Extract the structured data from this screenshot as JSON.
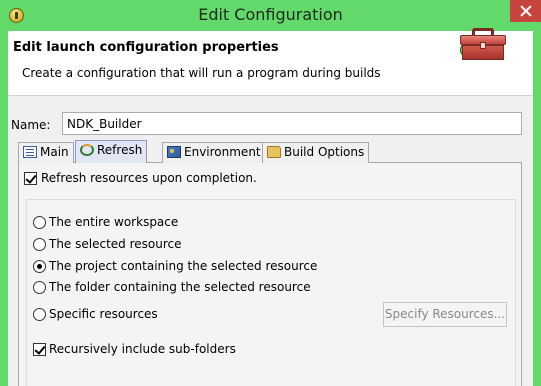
{
  "window": {
    "title": "Edit Configuration"
  },
  "header": {
    "heading": "Edit launch configuration properties",
    "description": "Create a configuration that will run a program during builds"
  },
  "name": {
    "label": "Name:",
    "value": "NDK_Builder"
  },
  "tabs": [
    {
      "label": "Main",
      "icon": "main-tab-icon",
      "active": false
    },
    {
      "label": "Refresh",
      "icon": "refresh-icon",
      "active": true
    },
    {
      "label": "Environment",
      "icon": "environment-icon",
      "active": false
    },
    {
      "label": "Build Options",
      "icon": "build-options-icon",
      "active": false
    }
  ],
  "refresh": {
    "refresh_on_completion": {
      "label": "Refresh resources upon completion.",
      "checked": true
    },
    "scope_options": [
      {
        "label": "The entire workspace",
        "selected": false
      },
      {
        "label": "The selected resource",
        "selected": false
      },
      {
        "label": "The project containing the selected resource",
        "selected": true
      },
      {
        "label": "The folder containing the selected resource",
        "selected": false
      },
      {
        "label": "Specific resources",
        "selected": false
      }
    ],
    "specify_button": "Specify Resources...",
    "recursive": {
      "label": "Recursively include sub-folders",
      "checked": true
    }
  }
}
